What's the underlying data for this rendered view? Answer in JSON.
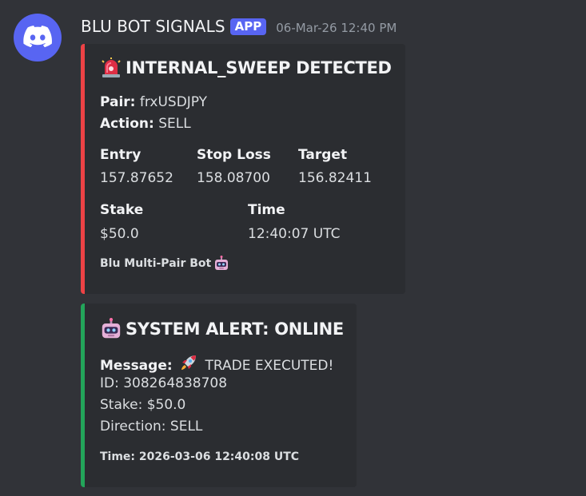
{
  "message": {
    "username": "BLU BOT SIGNALS",
    "badge": "APP",
    "timestamp": "06-Mar-26 12:40 PM",
    "avatar_icon": "discord-logo-icon",
    "colors": {
      "avatar_bg": "#5865f2",
      "badge_bg": "#5865f2",
      "embed_bg": "#2b2d31",
      "background": "#313338"
    }
  },
  "embeds": [
    {
      "accent_color": "#ed4245",
      "title_icon": "siren-icon",
      "title": "INTERNAL_SWEEP DETECTED",
      "pair_label": "Pair:",
      "pair_value": "frxUSDJPY",
      "action_label": "Action:",
      "action_value": "SELL",
      "fields": [
        {
          "name": "Entry",
          "value": "157.87652"
        },
        {
          "name": "Stop Loss",
          "value": "158.08700"
        },
        {
          "name": "Target",
          "value": "156.82411"
        },
        {
          "name": "Stake",
          "value": "$50.0"
        },
        {
          "name": "Time",
          "value": "12:40:07 UTC"
        }
      ],
      "footer": "Blu Multi-Pair Bot",
      "footer_icon": "robot-icon"
    },
    {
      "accent_color": "#23a55a",
      "title_icon": "robot-icon",
      "title": "SYSTEM ALERT: ONLINE",
      "message_label": "Message:",
      "message_icon": "rocket-icon",
      "message_value": "TRADE EXECUTED!",
      "lines": [
        "ID: 308264838708",
        "Stake: $50.0",
        "Direction: SELL"
      ],
      "footer": "Time: 2026-03-06 12:40:08 UTC"
    }
  ]
}
